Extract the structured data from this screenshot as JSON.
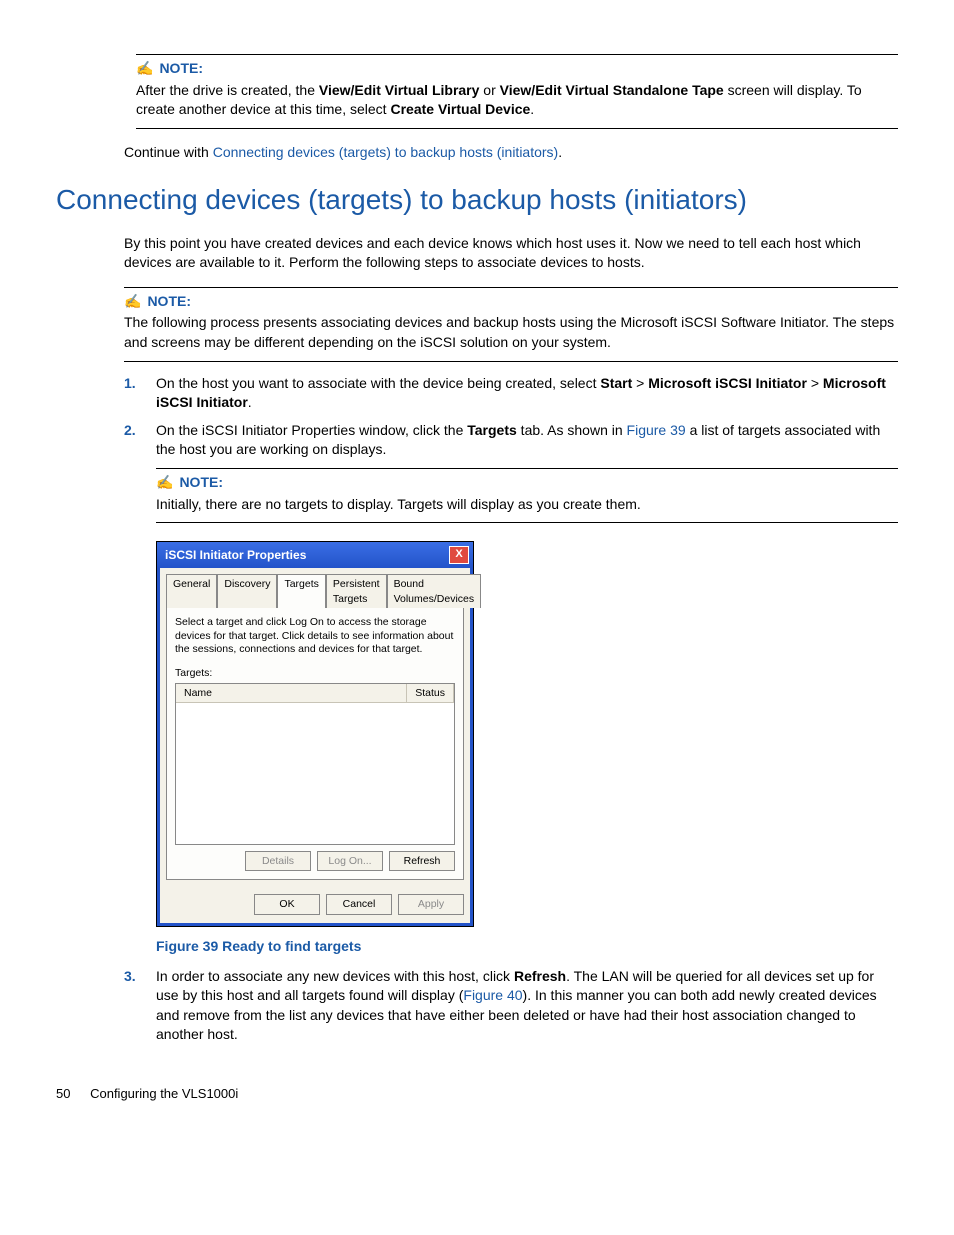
{
  "note1": {
    "label": "NOTE:",
    "text_pre": "After the drive is created, the ",
    "bold1": "View/Edit Virtual Library",
    "text_mid1": " or ",
    "bold2": "View/Edit Virtual Standalone Tape",
    "text_mid2": " screen will display. To create another device at this time, select ",
    "bold3": "Create Virtual Device",
    "text_post": "."
  },
  "continue": {
    "text": "Continue with ",
    "link": "Connecting devices (targets) to backup hosts (initiators)",
    "post": "."
  },
  "heading": "Connecting devices (targets) to backup hosts (initiators)",
  "intro": "By this point you have created devices and each device knows which host uses it. Now we need to tell each host which devices are available to it. Perform the following steps to associate devices to hosts.",
  "note2": {
    "label": "NOTE:",
    "text": "The following process presents associating devices and backup hosts using the Microsoft iSCSI Software Initiator. The steps and screens may be different depending on the iSCSI solution on your system."
  },
  "steps": {
    "s1": {
      "num": "1.",
      "pre": "On the host you want to associate with the device being created, select ",
      "b1": "Start",
      "gt1": " > ",
      "b2": "Microsoft iSCSI Initiator",
      "gt2": " > ",
      "b3": "Microsoft iSCSI Initiator",
      "post": "."
    },
    "s2": {
      "num": "2.",
      "pre": "On the iSCSI Initiator Properties window, click the ",
      "b1": "Targets",
      "mid": " tab. As shown in ",
      "link": "Figure 39",
      "post": " a list of targets associated with the host you are working on displays."
    },
    "s3": {
      "num": "3.",
      "pre": "In order to associate any new devices with this host, click ",
      "b1": "Refresh",
      "mid": ". The LAN will be queried for all devices set up for use by this host and all targets found will display (",
      "link": "Figure 40",
      "post": "). In this manner you can both add newly created devices and remove from the list any devices that have either been deleted or have had their host association changed to another host."
    }
  },
  "note3": {
    "label": "NOTE:",
    "text": "Initially, there are no targets to display. Targets will display as you create them."
  },
  "figure_caption": "Figure 39 Ready to find targets",
  "win": {
    "title": "iSCSI Initiator Properties",
    "tabs": [
      "General",
      "Discovery",
      "Targets",
      "Persistent Targets",
      "Bound Volumes/Devices"
    ],
    "instr": "Select a target and click Log On to access the storage devices for that target. Click details to see information about the sessions, connections and devices for that target.",
    "targets_label": "Targets:",
    "col_name": "Name",
    "col_status": "Status",
    "btn_details": "Details",
    "btn_logon": "Log On...",
    "btn_refresh": "Refresh",
    "btn_ok": "OK",
    "btn_cancel": "Cancel",
    "btn_apply": "Apply"
  },
  "footer": {
    "page": "50",
    "chapter": "Configuring the VLS1000i"
  }
}
